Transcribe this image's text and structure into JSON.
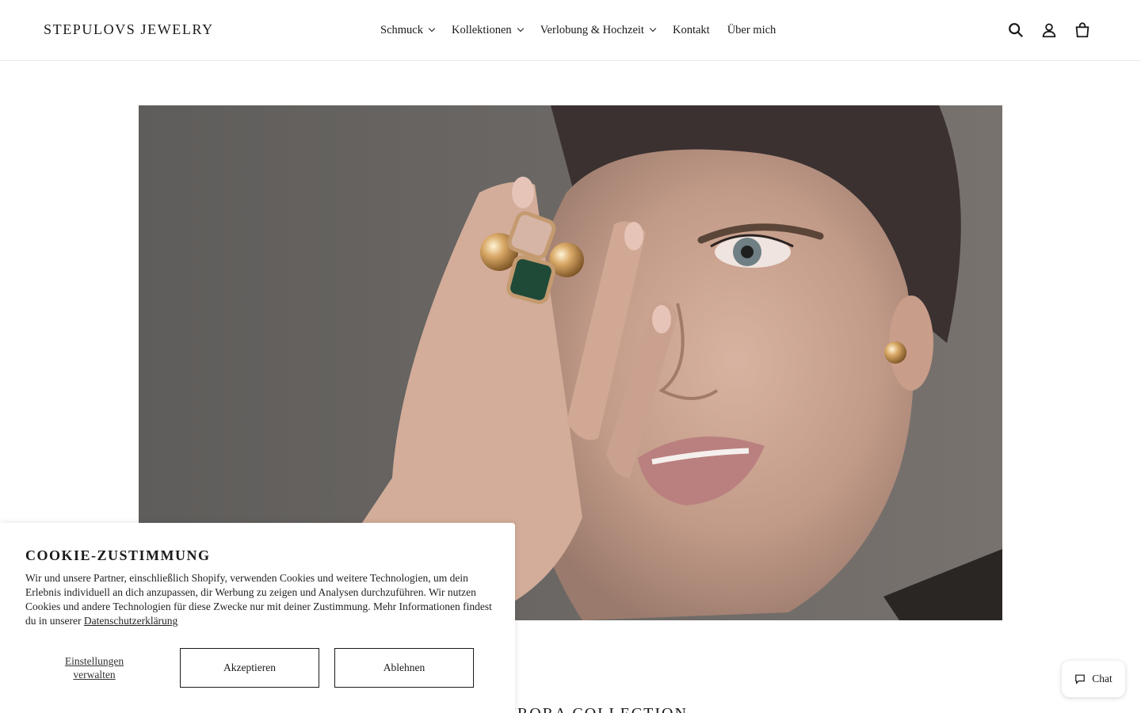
{
  "header": {
    "logo": "STEPULOVS JEWELRY",
    "nav": [
      {
        "label": "Schmuck",
        "dropdown": true
      },
      {
        "label": "Kollektionen",
        "dropdown": true
      },
      {
        "label": "Verlobung & Hochzeit",
        "dropdown": true
      },
      {
        "label": "Kontakt",
        "dropdown": false
      },
      {
        "label": "Über mich",
        "dropdown": false
      }
    ],
    "icons": [
      "search-icon",
      "account-icon",
      "cart-icon"
    ]
  },
  "hero": {
    "image": "model-wearing-ring-and-earring"
  },
  "collection": {
    "title": "AURORA COLLECTION"
  },
  "cookie": {
    "title": "COOKIE-ZUSTIMMUNG",
    "text": "Wir und unsere Partner, einschließlich Shopify, verwenden Cookies und weitere Technologien, um dein Erlebnis individuell an dich anzupassen, dir Werbung zu zeigen und Analysen durchzuführen. Wir nutzen Cookies und andere Technologien für diese Zwecke nur mit deiner Zustimmung. Mehr Informationen findest du in unserer",
    "privacy_link": "Datenschutzerklärung",
    "manage_label": "Einstellungen verwalten",
    "accept_label": "Akzeptieren",
    "decline_label": "Ablehnen"
  },
  "chat": {
    "label": "Chat"
  },
  "colors": {
    "text": "#1a1a1a",
    "hero_bg": "#6a6866"
  }
}
